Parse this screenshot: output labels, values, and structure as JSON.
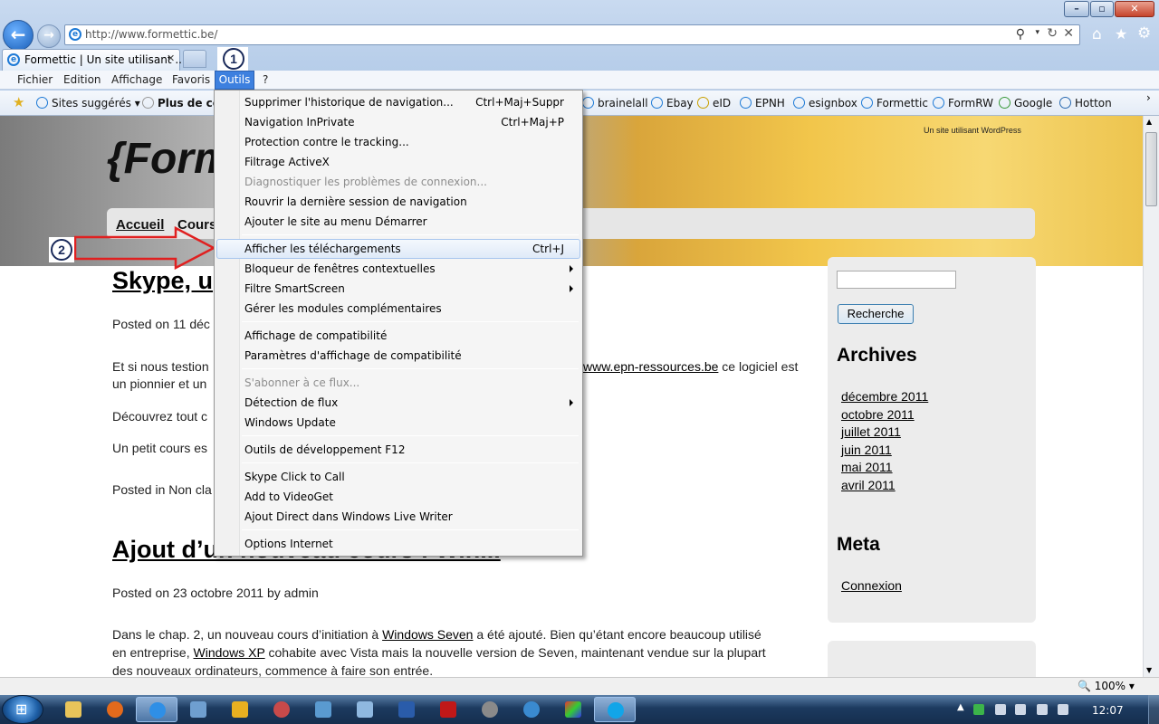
{
  "browser": {
    "address_url": "http://www.formettic.be/",
    "tab_title": "Formettic | Un site utilisant ...",
    "zoom": "100%"
  },
  "menubar": [
    "Fichier",
    "Edition",
    "Affichage",
    "Favoris",
    "Outils",
    "?"
  ],
  "favorites": {
    "suggested": "Sites suggérés",
    "more": "Plus de co",
    "items": [
      "brainelall",
      "Ebay",
      "eID",
      "EPNH",
      "esignbox",
      "Formettic",
      "FormRW",
      "Google",
      "Hotton"
    ]
  },
  "tools_menu": [
    {
      "label": "Supprimer l'historique de navigation...",
      "shortcut": "Ctrl+Maj+Suppr"
    },
    {
      "label": "Navigation InPrivate",
      "shortcut": "Ctrl+Maj+P"
    },
    {
      "label": "Protection contre le tracking...",
      "shortcut": ""
    },
    {
      "label": "Filtrage ActiveX",
      "shortcut": ""
    },
    {
      "label": "Diagnostiquer les problèmes de connexion...",
      "shortcut": "",
      "disabled": true
    },
    {
      "label": "Rouvrir la dernière session de navigation",
      "shortcut": ""
    },
    {
      "label": "Ajouter le site au menu Démarrer",
      "shortcut": ""
    },
    {
      "label": "Afficher les téléchargements",
      "shortcut": "Ctrl+J",
      "highlighted": true
    },
    {
      "label": "Bloqueur de fenêtres contextuelles",
      "submenu": true
    },
    {
      "label": "Filtre SmartScreen",
      "submenu": true
    },
    {
      "label": "Gérer les modules complémentaires"
    },
    {
      "label": "Affichage de compatibilité"
    },
    {
      "label": "Paramètres d'affichage de compatibilité"
    },
    {
      "label": "S'abonner à ce flux...",
      "disabled": true
    },
    {
      "label": "Détection de flux",
      "submenu": true
    },
    {
      "label": "Windows Update"
    },
    {
      "label": "Outils de développement F12"
    },
    {
      "label": "Skype Click to Call"
    },
    {
      "label": "Add to VideoGet"
    },
    {
      "label": "Ajout Direct dans Windows Live Writer"
    },
    {
      "label": "Options Internet"
    }
  ],
  "annotations": {
    "step1": "1",
    "step2": "2"
  },
  "site": {
    "tagline": "Un site utilisant WordPress",
    "logo": "{Form",
    "nav": [
      "Accueil",
      "Cours"
    ],
    "post1": {
      "title": "Skype, u",
      "meta": "Posted on 11 déc",
      "p1a": "Et si nous testion",
      "p1link": "www.epn-ressources.be",
      "p1b": " ce logiciel est",
      "p1c": "un pionnier et un",
      "p2": "Découvrez tout c",
      "p3": "Un petit cours es",
      "posted_in": "Posted in Non cla"
    },
    "post2": {
      "title": "Ajout d’un nouveau cours : Win...",
      "meta": "Posted on 23 octobre 2011 by admin",
      "t1": "Dans le chap. 2, un nouveau cours d’initiation à ",
      "l1": "Windows Seven",
      "t2": " a été ajouté. Bien qu’étant encore beaucoup utilisé",
      "t3": "en entreprise, ",
      "l2": "Windows XP",
      "t4": " cohabite avec Vista mais la nouvelle version de Seven, maintenant vendue sur la plupart",
      "t5": "des nouveaux ordinateurs, commence à faire son entrée."
    },
    "sidebar": {
      "search_button": "Recherche",
      "archives_title": "Archives",
      "archives": [
        "décembre 2011",
        "octobre 2011",
        "juillet 2011",
        "juin 2011",
        "mai 2011",
        "avril 2011"
      ],
      "meta_title": "Meta",
      "meta_link": "Connexion"
    }
  },
  "taskbar": {
    "clock": "12:07"
  }
}
